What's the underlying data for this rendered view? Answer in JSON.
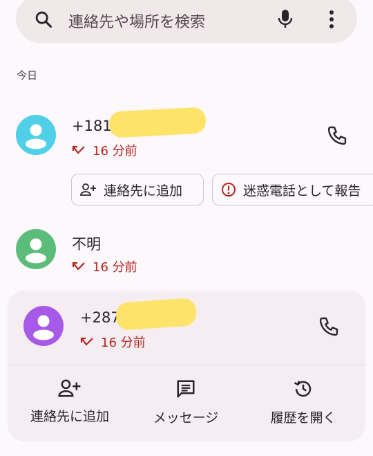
{
  "search": {
    "placeholder": "連絡先や場所を検索",
    "icons": [
      "search-icon",
      "mic-icon",
      "more-vert-icon"
    ]
  },
  "section": {
    "today": "今日"
  },
  "calls": [
    {
      "name": "+1818",
      "time": "16 分前",
      "avatar_color": "#4fcfe8",
      "type": "missed"
    },
    {
      "name": "不明",
      "time": "16 分前",
      "avatar_color": "#5bbd79",
      "type": "missed"
    },
    {
      "name": "+2879",
      "time": "16 分前",
      "avatar_color": "#a75ae8",
      "type": "missed"
    }
  ],
  "chips": {
    "add_contact": "連絡先に追加",
    "report_spam": "迷惑電話として報告"
  },
  "expanded_actions": {
    "add_contact": "連絡先に追加",
    "message": "メッセージ",
    "history": "履歴を開く"
  },
  "colors": {
    "missed": "#b3261e",
    "background": "#fdf8fc",
    "card": "#f5edf1",
    "redaction": "#fde36a"
  }
}
